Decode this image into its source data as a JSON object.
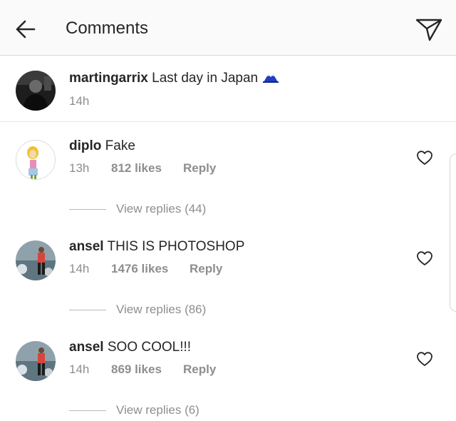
{
  "header": {
    "title": "Comments",
    "back_icon": "arrow-left-icon",
    "send_icon": "paper-plane-icon"
  },
  "caption": {
    "username": "martingarrix",
    "text": "Last day in Japan",
    "emoji_icon": "mount-fuji-icon",
    "time": "14h"
  },
  "comments": [
    {
      "username": "diplo",
      "text": "Fake",
      "time": "13h",
      "likes": "812 likes",
      "reply_label": "Reply",
      "view_replies": "View replies (44)"
    },
    {
      "username": "ansel",
      "text": "THIS IS PHOTOSHOP",
      "time": "14h",
      "likes": "1476 likes",
      "reply_label": "Reply",
      "view_replies": "View replies (86)"
    },
    {
      "username": "ansel",
      "text": "SOO COOL!!!",
      "time": "14h",
      "likes": "869 likes",
      "reply_label": "Reply",
      "view_replies": "View replies (6)"
    }
  ],
  "colors": {
    "primary_text": "#262626",
    "secondary_text": "#8e8e8e",
    "header_bg": "#fafafa",
    "divider": "#dbdbdb"
  }
}
